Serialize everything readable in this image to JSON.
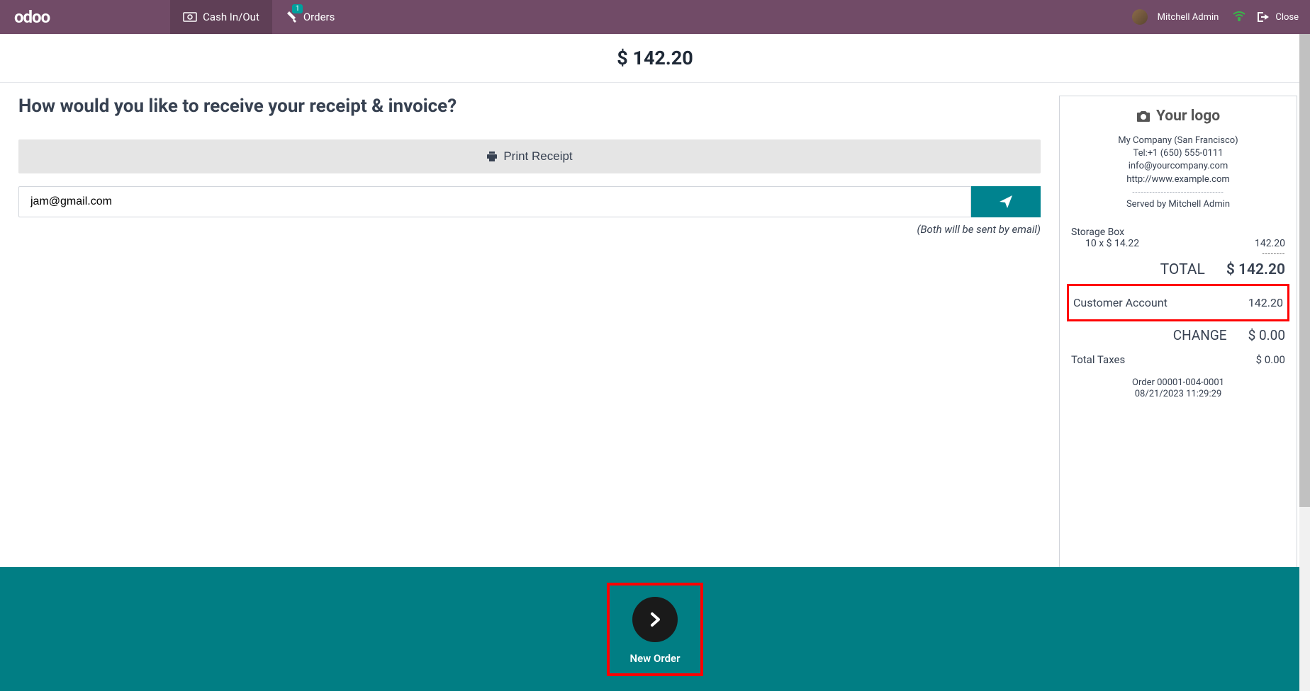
{
  "header": {
    "logo": "odoo",
    "cash_in_out": "Cash In/Out",
    "orders": "Orders",
    "orders_badge": "1",
    "user_name": "Mitchell Admin",
    "close": "Close"
  },
  "total_bar": "$ 142.20",
  "left_panel": {
    "question": "How would you like to receive your receipt & invoice?",
    "print_label": "Print Receipt",
    "email_value": "jam@gmail.com",
    "email_note": "(Both will be sent by email)"
  },
  "receipt": {
    "logo_text": "Your logo",
    "company": "My Company (San Francisco)",
    "tel": "Tel:+1 (650) 555-0111",
    "email": "info@yourcompany.com",
    "website": "http://www.example.com",
    "served_by": "Served by Mitchell Admin",
    "item_name": "Storage Box",
    "item_qty": "10 x $ 14.22",
    "item_amount": "142.20",
    "total_label": "TOTAL",
    "total_value": "$ 142.20",
    "payment_method": "Customer Account",
    "payment_amount": "142.20",
    "change_label": "CHANGE",
    "change_value": "$ 0.00",
    "taxes_label": "Total Taxes",
    "taxes_value": "$ 0.00",
    "order_number": "Order 00001-004-0001",
    "order_date": "08/21/2023 11:29:29"
  },
  "footer": {
    "new_order": "New Order"
  }
}
